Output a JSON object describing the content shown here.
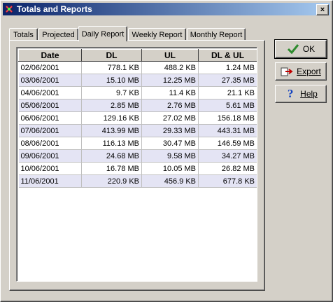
{
  "window": {
    "title": "Totals and Reports",
    "close_glyph": "×"
  },
  "tabs": [
    "Totals",
    "Projected",
    "Daily Report",
    "Weekly Report",
    "Monthly Report"
  ],
  "active_tab": "Daily Report",
  "table": {
    "columns": [
      "Date",
      "DL",
      "UL",
      "DL & UL"
    ],
    "rows": [
      [
        "02/06/2001",
        "778.1 KB",
        "488.2 KB",
        "1.24 MB"
      ],
      [
        "03/06/2001",
        "15.10 MB",
        "12.25 MB",
        "27.35 MB"
      ],
      [
        "04/06/2001",
        "9.7 KB",
        "11.4 KB",
        "21.1 KB"
      ],
      [
        "05/06/2001",
        "2.85 MB",
        "2.76 MB",
        "5.61 MB"
      ],
      [
        "06/06/2001",
        "129.16 KB",
        "27.02 MB",
        "156.18 MB"
      ],
      [
        "07/06/2001",
        "413.99 MB",
        "29.33 MB",
        "443.31 MB"
      ],
      [
        "08/06/2001",
        "116.13 MB",
        "30.47 MB",
        "146.59 MB"
      ],
      [
        "09/06/2001",
        "24.68 MB",
        "9.58 MB",
        "34.27 MB"
      ],
      [
        "10/06/2001",
        "16.78 MB",
        "10.05 MB",
        "26.82 MB"
      ],
      [
        "11/06/2001",
        "220.9 KB",
        "456.9 KB",
        "677.8 KB"
      ]
    ]
  },
  "buttons": {
    "ok": "OK",
    "export": "Export",
    "help": "Help"
  },
  "icons": {
    "ok": "checkmark-icon",
    "export": "export-icon",
    "help": "help-question-icon",
    "app": "app-icon"
  },
  "colors": {
    "titlebar_start": "#0a246a",
    "titlebar_end": "#a6caf0",
    "row_alt": "#e4e4f4",
    "ok_check": "#2e8b2e",
    "help_q": "#1040c0"
  }
}
